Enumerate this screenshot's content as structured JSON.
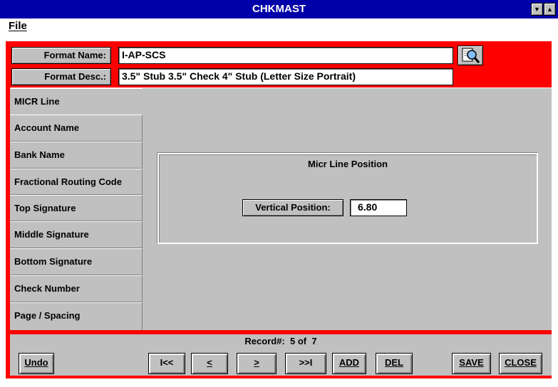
{
  "window": {
    "title": "CHKMAST",
    "minimize_glyph": "▼",
    "maximize_glyph": "▲"
  },
  "menu": {
    "file_label": "File"
  },
  "header": {
    "format_name_label": "Format Name:",
    "format_name_value": "I-AP-SCS",
    "format_desc_label": "Format Desc.:",
    "format_desc_value": "3.5\" Stub 3.5\" Check 4\" Stub (Letter Size Portrait)",
    "lookup_icon": "magnifier-icon"
  },
  "tabs": [
    {
      "label": "MICR Line",
      "active": true
    },
    {
      "label": "Account Name",
      "active": false
    },
    {
      "label": "Bank Name",
      "active": false
    },
    {
      "label": "Fractional Routing Code",
      "active": false
    },
    {
      "label": "Top Signature",
      "active": false
    },
    {
      "label": "Middle Signature",
      "active": false
    },
    {
      "label": "Bottom Signature",
      "active": false
    },
    {
      "label": "Check Number",
      "active": false
    },
    {
      "label": "Page / Spacing",
      "active": false
    }
  ],
  "micr_panel": {
    "title": "Micr Line Position",
    "vertical_label": "Vertical Position:",
    "vertical_value": "6.80"
  },
  "footer": {
    "record_label": "Record#:",
    "record_text": "5 of  7",
    "undo_label": "Undo",
    "first_label": "I<<",
    "prev_label": "<",
    "next_label": ">",
    "last_label": ">>I",
    "add_label": "ADD",
    "del_label": "DEL",
    "save_label": "SAVE",
    "close_label": "CLOSE"
  },
  "colors": {
    "titlebar": "#0000a8",
    "background_panel": "#ff0000",
    "face": "#c0c0c0"
  }
}
